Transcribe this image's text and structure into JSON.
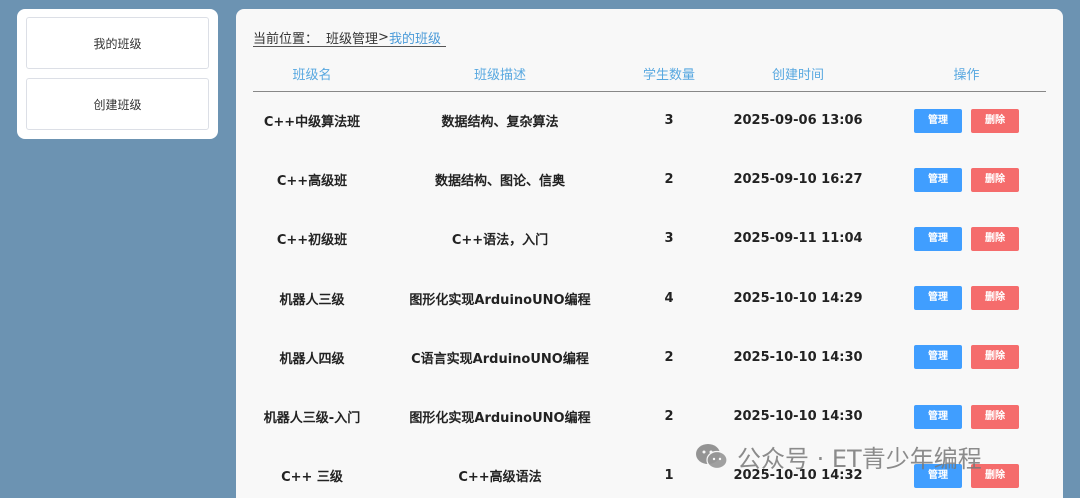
{
  "sidebar": {
    "items": [
      {
        "label": "我的班级"
      },
      {
        "label": "创建班级"
      }
    ]
  },
  "breadcrumb": {
    "prefix": "当前位置：",
    "section": "班级管理",
    "separator": ">",
    "current": "我的班级"
  },
  "table": {
    "headers": [
      "班级名",
      "班级描述",
      "学生数量",
      "创建时间",
      "操作"
    ],
    "manage_label": "管理",
    "delete_label": "删除",
    "rows": [
      {
        "name": "C++中级算法班",
        "desc": "数据结构、复杂算法",
        "count": "3",
        "time": "2025-09-06 13:06"
      },
      {
        "name": "C++高级班",
        "desc": "数据结构、图论、信奥",
        "count": "2",
        "time": "2025-09-10 16:27"
      },
      {
        "name": "C++初级班",
        "desc": "C++语法，入门",
        "count": "3",
        "time": "2025-09-11 11:04"
      },
      {
        "name": "机器人三级",
        "desc": "图形化实现ArduinoUNO编程",
        "count": "4",
        "time": "2025-10-10 14:29"
      },
      {
        "name": "机器人四级",
        "desc": "C语言实现ArduinoUNO编程",
        "count": "2",
        "time": "2025-10-10 14:30"
      },
      {
        "name": "机器人三级-入门",
        "desc": "图形化实现ArduinoUNO编程",
        "count": "2",
        "time": "2025-10-10 14:30"
      },
      {
        "name": "C++ 三级",
        "desc": "C++高级语法",
        "count": "1",
        "time": "2025-10-10 14:32"
      }
    ]
  },
  "watermark": {
    "text": "公众号 · ET青少年编程",
    "icon": "wechat-icon"
  }
}
